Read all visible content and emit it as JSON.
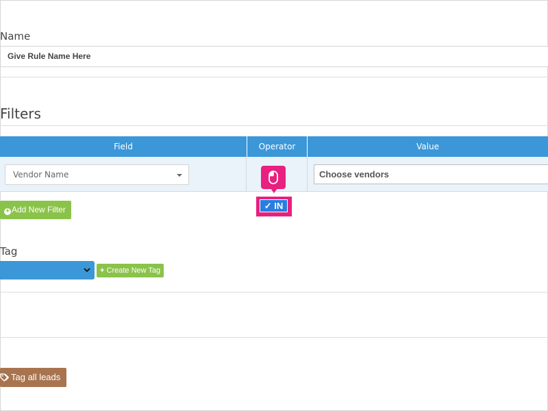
{
  "rule": {
    "name_label": "Name",
    "name_value": "Give Rule Name Here"
  },
  "filters": {
    "title": "Filters",
    "columns": [
      "Field",
      "Operator",
      "Value"
    ],
    "rows": [
      {
        "field": "Vendor Name",
        "operator": "IN",
        "value_placeholder": "Choose vendors"
      }
    ],
    "operator_option_label": "✓ IN",
    "add_filter_label": "Add New Filter"
  },
  "tag": {
    "label": "Tag",
    "selected": "",
    "create_label": "Create New Tag"
  },
  "actions": {
    "tag_all_label": "Tag all leads"
  },
  "colors": {
    "header_blue": "#3b97d8",
    "green_button": "#8bc34a",
    "brown_button": "#a8744f",
    "highlight_pink": "#e8207f",
    "option_blue": "#2a7de1"
  },
  "icons": [
    "caret-down-icon",
    "mouse-icon",
    "plus-circle-icon",
    "chevron-down-icon",
    "plus-icon",
    "tags-icon"
  ]
}
